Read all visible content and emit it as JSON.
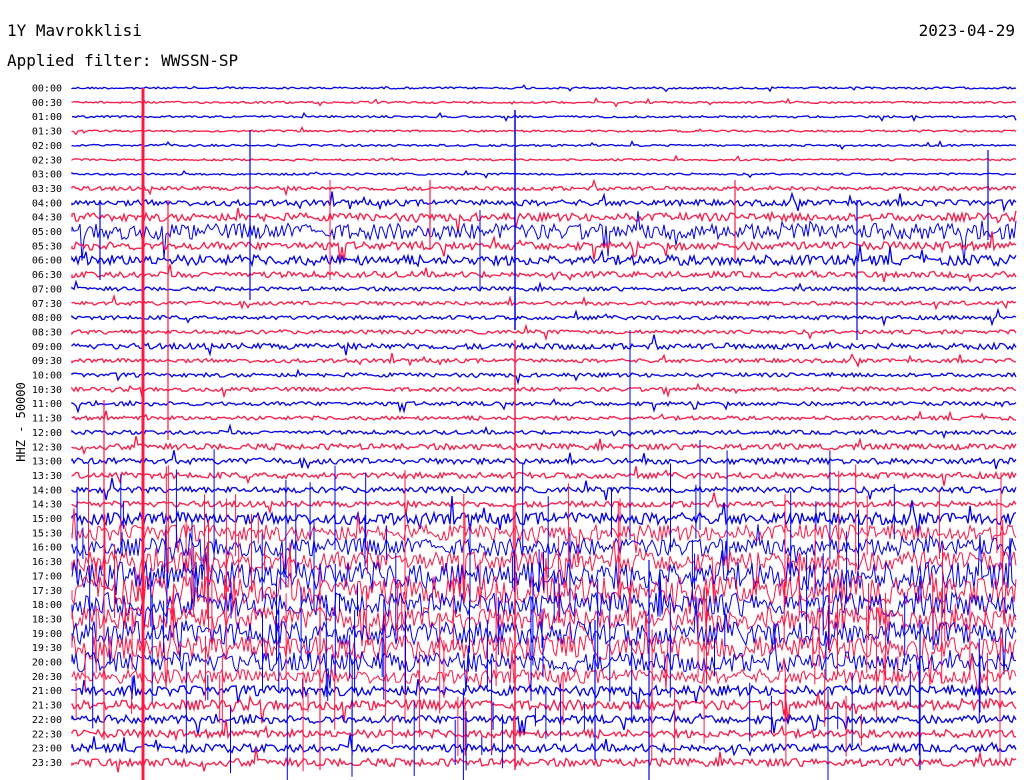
{
  "header": {
    "station": "1Y Mavrokklisi",
    "date": "2023-04-29",
    "filter": "Applied filter: WWSSN-SP",
    "channel": "HHZ - 50000"
  },
  "colors": {
    "a": "#0000ee",
    "b": "#ff1744"
  },
  "chart_data": {
    "type": "line",
    "title": "1Y Mavrokklisi",
    "ylabel": "HHZ - 50000",
    "row_labels": [
      "00:00",
      "00:30",
      "01:00",
      "01:30",
      "02:00",
      "02:30",
      "03:00",
      "03:30",
      "04:00",
      "04:30",
      "05:00",
      "05:30",
      "06:00",
      "06:30",
      "07:00",
      "07:30",
      "08:00",
      "08:30",
      "09:00",
      "09:30",
      "10:00",
      "10:30",
      "11:00",
      "11:30",
      "12:00",
      "12:30",
      "13:00",
      "13:30",
      "14:00",
      "14:30",
      "15:00",
      "15:30",
      "16:00",
      "16:30",
      "17:00",
      "17:30",
      "18:00",
      "18:30",
      "19:00",
      "19:30",
      "20:00",
      "20:30",
      "21:00",
      "21:30",
      "22:00",
      "22:30",
      "23:00",
      "23:30"
    ],
    "series": [
      {
        "values": [
          1,
          1,
          1,
          1,
          1,
          1,
          1,
          2,
          3,
          4,
          8,
          4,
          5,
          3,
          2,
          2,
          2,
          2,
          3,
          2,
          2,
          2,
          2,
          2,
          2,
          3,
          3,
          3,
          3,
          3,
          6,
          8,
          9,
          10,
          14,
          14,
          12,
          12,
          12,
          12,
          10,
          7,
          5,
          5,
          4,
          4,
          4,
          4
        ]
      }
    ]
  }
}
